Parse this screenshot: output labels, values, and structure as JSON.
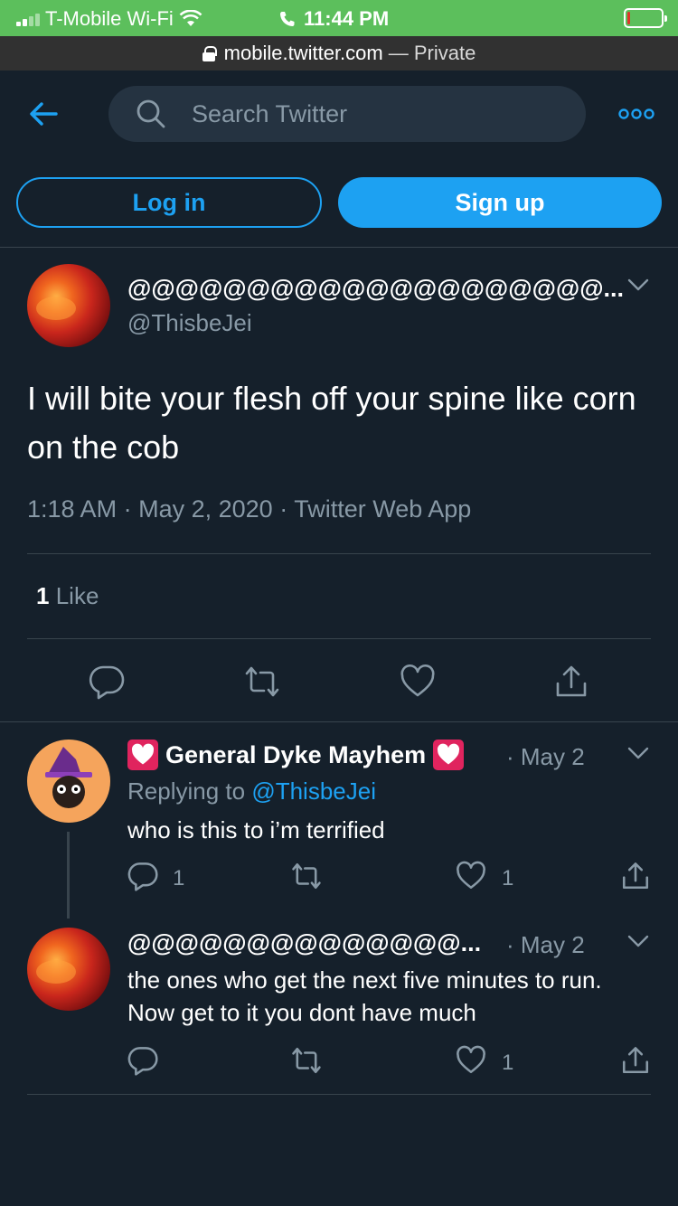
{
  "status_bar": {
    "carrier": "T-Mobile Wi-Fi",
    "time": "11:44 PM",
    "battery_level": 0.08
  },
  "browser": {
    "domain": "mobile.twitter.com",
    "mode": "— Private"
  },
  "header": {
    "search_placeholder": "Search Twitter",
    "login_label": "Log in",
    "signup_label": "Sign up"
  },
  "main_tweet": {
    "display_name": "@@@@@@@@@@@@@@@@@@@@...",
    "handle": "@ThisbeJei",
    "text": "I will bite your flesh off your spine like corn on the cob",
    "time": "1:18 AM",
    "date": "May 2, 2020",
    "source": "Twitter Web App",
    "separator": "·",
    "like_count": "1",
    "like_label": "Like"
  },
  "replies": [
    {
      "display_name": "General Dyke Mayhem",
      "date": "· May 2",
      "replying_label": "Replying to",
      "replying_to": "@ThisbeJei",
      "text": "who is this to i’m terrified",
      "reply_count": "1",
      "like_count": "1"
    },
    {
      "display_name": "@@@@@@@@@@@@@@...",
      "date": "· May 2",
      "text": "the ones who get the next five minutes to run. Now get to it you dont have much",
      "like_count": "1"
    }
  ],
  "colors": {
    "background": "#15202b",
    "accent": "#1da1f2",
    "muted": "#8899a6",
    "divider": "#38444d",
    "status_bar": "#5cbf5c"
  }
}
